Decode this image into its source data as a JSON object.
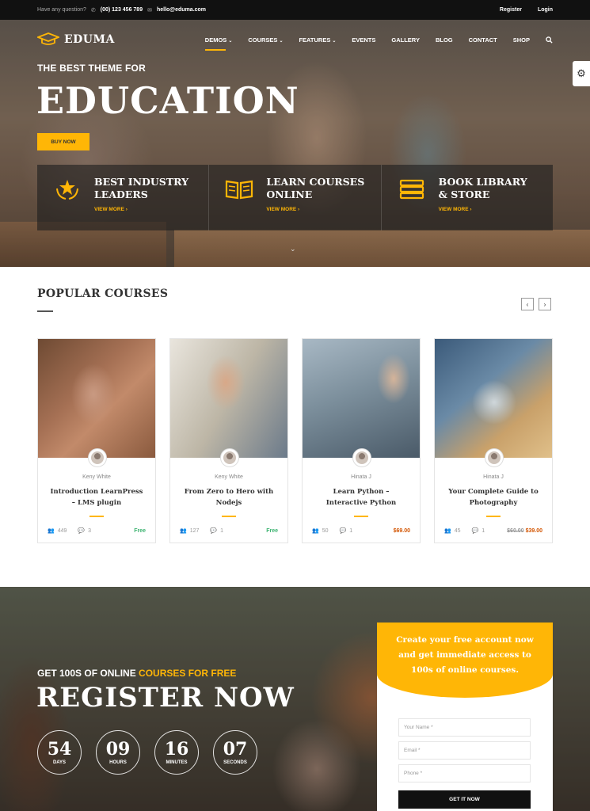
{
  "topbar": {
    "question": "Have any question?",
    "phone": "(00) 123 456 789",
    "email": "hello@eduma.com",
    "register": "Register",
    "login": "Login"
  },
  "brand": {
    "name": "EDUMA"
  },
  "nav": {
    "items": [
      {
        "label": "DEMOS",
        "dropdown": true,
        "active": true
      },
      {
        "label": "COURSES",
        "dropdown": true
      },
      {
        "label": "FEATURES",
        "dropdown": true
      },
      {
        "label": "EVENTS"
      },
      {
        "label": "GALLERY"
      },
      {
        "label": "BLOG"
      },
      {
        "label": "CONTACT"
      },
      {
        "label": "SHOP"
      }
    ]
  },
  "hero": {
    "subtitle": "THE BEST THEME FOR",
    "title": "EDUCATION",
    "button": "BUY NOW",
    "features": [
      {
        "title_line1": "BEST INDUSTRY",
        "title_line2": "LEADERS",
        "link": "VIEW MORE ›",
        "icon": "laurel-star-icon"
      },
      {
        "title_line1": "LEARN COURSES",
        "title_line2": "ONLINE",
        "link": "VIEW MORE ›",
        "icon": "open-book-icon"
      },
      {
        "title_line1": "BOOK LIBRARY",
        "title_line2": "& STORE",
        "link": "VIEW MORE ›",
        "icon": "book-stack-icon"
      }
    ]
  },
  "popular": {
    "title": "POPULAR COURSES",
    "prev": "‹",
    "next": "›",
    "courses": [
      {
        "teacher": "Keny White",
        "title": "Introduction LearnPress – LMS plugin",
        "students": "449",
        "comments": "3",
        "price": "Free",
        "old_price": ""
      },
      {
        "teacher": "Keny White",
        "title": "From Zero to Hero with Nodejs",
        "students": "127",
        "comments": "1",
        "price": "Free",
        "old_price": ""
      },
      {
        "teacher": "Hinata J",
        "title": "Learn Python – Interactive Python",
        "students": "50",
        "comments": "1",
        "price": "$69.00",
        "old_price": ""
      },
      {
        "teacher": "Hinata J",
        "title": "Your Complete Guide to Photography",
        "students": "45",
        "comments": "1",
        "price": "$39.00",
        "old_price": "$60.00"
      }
    ]
  },
  "register": {
    "subtitle_prefix": "GET 100S OF ONLINE",
    "subtitle_highlight": "COURSES FOR FREE",
    "title": "REGISTER NOW",
    "countdown": [
      {
        "value": "54",
        "label": "DAYS"
      },
      {
        "value": "09",
        "label": "HOURS"
      },
      {
        "value": "16",
        "label": "MINUTES"
      },
      {
        "value": "07",
        "label": "SECONDS"
      }
    ],
    "form": {
      "heading_line1": "Create your free account now",
      "heading_line2": "and get immediate access to",
      "heading_line3": "100s of online courses.",
      "name_placeholder": "Your Name *",
      "email_placeholder": "Email *",
      "phone_placeholder": "Phone *",
      "button": "GET IT NOW"
    }
  },
  "colors": {
    "accent": "#ffb606",
    "dark": "#111111"
  }
}
